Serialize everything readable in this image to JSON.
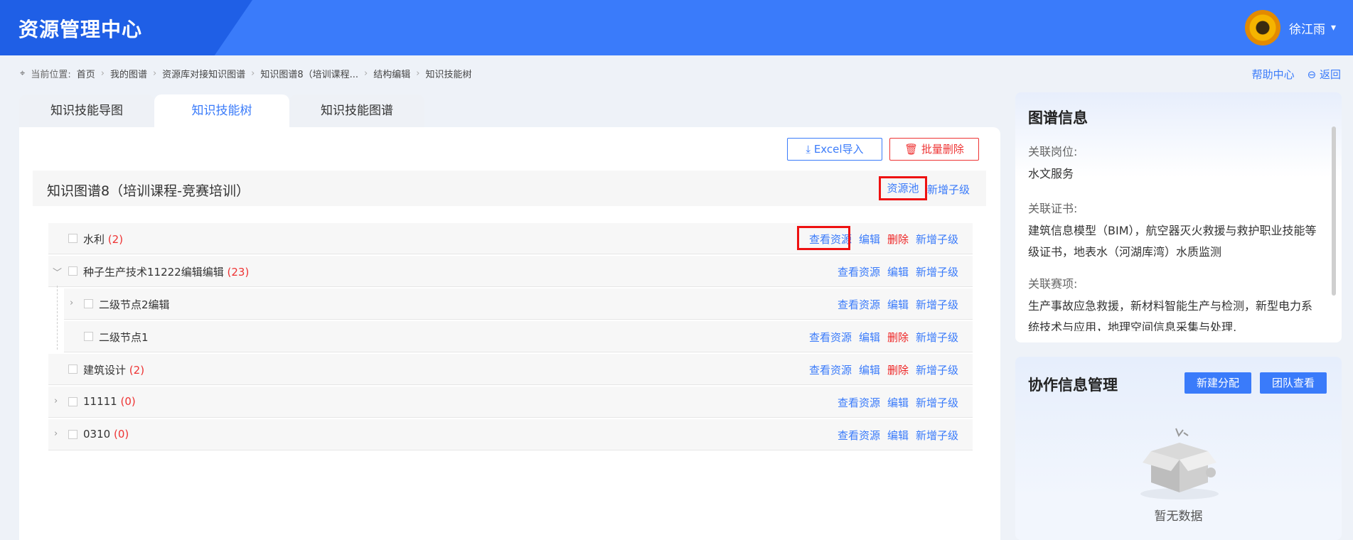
{
  "header": {
    "title": "资源管理中心",
    "user_name": "徐江雨"
  },
  "breadcrumb": {
    "prefix": "当前位置:",
    "items": [
      "首页",
      "我的图谱",
      "资源库对接知识图谱",
      "知识图谱8（培训课程...",
      "结构编辑",
      "知识技能树"
    ]
  },
  "topright": {
    "help": "帮助中心",
    "back": "返回"
  },
  "tabs": [
    {
      "label": "知识技能导图"
    },
    {
      "label": "知识技能树"
    },
    {
      "label": "知识技能图谱"
    }
  ],
  "toolbar": {
    "excel_import": "Excel导入",
    "batch_delete": "批量删除"
  },
  "tree": {
    "title": "知识图谱8（培训课程-竞赛培训）",
    "pool": "资源池",
    "add_child": "新增子级",
    "rows": [
      {
        "label": "水利",
        "count": "(2)",
        "view": "查看资源",
        "edit": "编辑",
        "delete": "删除",
        "add": "新增子级"
      },
      {
        "label": "种子生产技术11222编辑编辑",
        "count": "(23)",
        "view": "查看资源",
        "edit": "编辑",
        "add": "新增子级"
      },
      {
        "label": "二级节点2编辑",
        "view": "查看资源",
        "edit": "编辑",
        "add": "新增子级"
      },
      {
        "label": "二级节点1",
        "view": "查看资源",
        "edit": "编辑",
        "delete": "删除",
        "add": "新增子级"
      },
      {
        "label": "建筑设计",
        "count": "(2)",
        "view": "查看资源",
        "edit": "编辑",
        "delete": "删除",
        "add": "新增子级"
      },
      {
        "label": "11111",
        "count": "(0)",
        "view": "查看资源",
        "edit": "编辑",
        "add": "新增子级"
      },
      {
        "label": "0310",
        "count": "(0)",
        "view": "查看资源",
        "edit": "编辑",
        "add": "新增子级"
      }
    ]
  },
  "graph_info": {
    "title": "图谱信息",
    "post_label": "关联岗位:",
    "post_value": "水文服务",
    "cert_label": "关联证书:",
    "cert_value": "建筑信息模型（BIM），航空器灭火救援与救护职业技能等级证书，地表水（河湖库湾）水质监测",
    "event_label": "关联赛项:",
    "event_value": "生产事故应急救援，新材料智能生产与检测，新型电力系统技术与应用，地理空间信息采集与处理,"
  },
  "collab": {
    "title": "协作信息管理",
    "new_assign": "新建分配",
    "team_view": "团队查看",
    "empty": "暂无数据"
  }
}
